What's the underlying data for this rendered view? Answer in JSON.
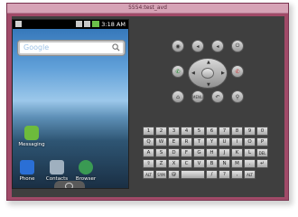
{
  "window": {
    "title": "5554:test_avd"
  },
  "status_bar": {
    "time": "3:18 AM"
  },
  "search": {
    "placeholder": "Google"
  },
  "apps": {
    "messaging": "Messaging",
    "phone": "Phone",
    "contacts": "Contacts",
    "browser": "Browser"
  },
  "controls": {
    "menu_label": "MENU"
  },
  "keyboard": {
    "row1": [
      "1",
      "2",
      "3",
      "4",
      "5",
      "6",
      "7",
      "8",
      "9",
      "0"
    ],
    "row2": [
      "Q",
      "W",
      "E",
      "R",
      "T",
      "Y",
      "U",
      "I",
      "O",
      "P"
    ],
    "row3": [
      "A",
      "S",
      "D",
      "F",
      "G",
      "H",
      "J",
      "K",
      "L",
      "DEL"
    ],
    "row4": [
      "⇧",
      "Z",
      "X",
      "C",
      "V",
      "B",
      "N",
      "M",
      ".",
      "↵"
    ],
    "row5": [
      "ALT",
      "SYM",
      "@",
      "",
      "/",
      "?",
      ",",
      "ALT"
    ]
  },
  "colors": {
    "window_frame": "#a04a68",
    "panel": "#3f3f3f",
    "accent": "#6cc04a"
  }
}
